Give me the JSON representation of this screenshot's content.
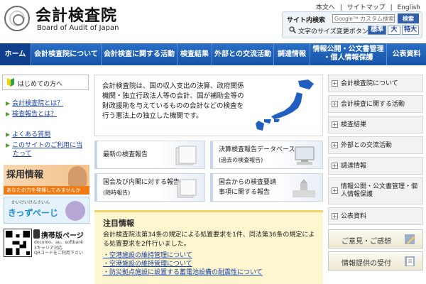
{
  "header": {
    "title": "会計検査院",
    "subtitle": "Board of Audit of Japan",
    "top_links": [
      "本文へ",
      "サイトマップ",
      "English"
    ],
    "search_label": "サイト内検索",
    "search_placeholder": "Google™ カスタム検索",
    "search_button": "検索",
    "fontsize_label": "文字のサイズ変更ボタン",
    "fontsize_buttons": [
      "標準",
      "大",
      "特大"
    ]
  },
  "nav": [
    "ホーム",
    "会計検査院について",
    "会計検査に関する活動",
    "検査結果",
    "外部との交流活動",
    "調達情報",
    "情報公開・公文書管理",
    "・個人情報保護",
    "公表資料"
  ],
  "left": {
    "beginner": "はじめての方へ",
    "links": [
      "会計検査院とは？",
      "検査報告とは？",
      "よくある質問",
      "このサイトのご利用に当",
      "たって"
    ],
    "recruit_title": "採用情報",
    "recruit_sub": "あなたの力を発揮してみませんか",
    "kids_sub": "かいけいけんさいん",
    "kids_title": "きっずぺーじ",
    "mobile_title": "携帯版ページ",
    "mobile_desc": [
      "docomo、au、softbank",
      "3キャリア対応",
      "QRコードをご利用下さい"
    ]
  },
  "center": {
    "intro": "会計検査院は、国の収入支出の決算、政府関係機関・独立行政法人等の会計、国が補助金等の財政援助を与えているものの会計などの検査を行う憲法上の独立した機関です。",
    "cards": [
      {
        "lines": [
          "最新の検査報告"
        ]
      },
      {
        "lines": [
          "決算検査報告データベース",
          "(過去の検査報告)"
        ]
      },
      {
        "lines": [
          "国会及び内閣に対する報告",
          "(随時報告)"
        ]
      },
      {
        "lines": [
          "国会からの検査要請",
          "事項に関する報告"
        ]
      }
    ],
    "notice_title": "注目情報",
    "notice_body": "会計検査院法第34条の規定による処置要求を1件、同法第36条の規定による処置要求を2件行いました。",
    "notice_links": [
      "・空港施設の維持管理について",
      "・空港施設の維持管理について",
      "・防災拠点施設に設置する蓄電池設備の耐震性について"
    ]
  },
  "right": {
    "items": [
      "会計検査院について",
      "会計検査に関する活動",
      "検査結果",
      "外部との交流活動",
      "調達情報",
      "情報公開・公文書管理・個人情報保護",
      "公表資料"
    ],
    "buttons": [
      "ご意見・ご感想",
      "情報提供の受付"
    ]
  },
  "colors": {
    "nav": "#1554a8",
    "accent": "#f07b15",
    "link": "#1a3fa6"
  }
}
